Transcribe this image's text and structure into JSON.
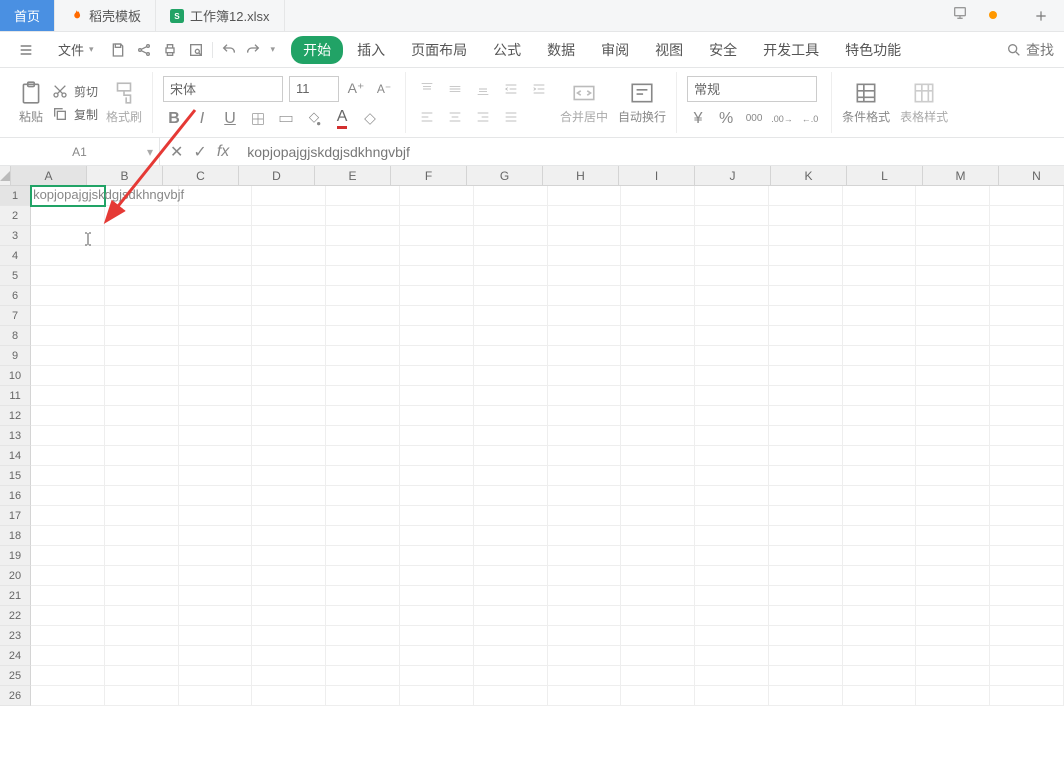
{
  "tabs": {
    "home": "首页",
    "template": "稻壳模板",
    "workbook": "工作簿12.xlsx"
  },
  "file_menu": "文件",
  "ribbon_tabs": {
    "start": "开始",
    "insert": "插入",
    "layout": "页面布局",
    "formula": "公式",
    "data": "数据",
    "review": "审阅",
    "view": "视图",
    "security": "安全",
    "dev": "开发工具",
    "special": "特色功能"
  },
  "search_label": "查找",
  "clipboard": {
    "paste": "粘贴",
    "cut": "剪切",
    "copy": "复制",
    "format_painter": "格式刷"
  },
  "font": {
    "name": "宋体",
    "size": "11",
    "bold": "B",
    "italic": "I",
    "underline": "U"
  },
  "merge": "合并居中",
  "wrap": "自动换行",
  "number_format": "常规",
  "cond_format": "条件格式",
  "table_style": "表格样式",
  "name_box": "A1",
  "fx_value": "kopjopajgjskdgjsdkhngvbjf",
  "cell_a1": "kopjopajgjskdgjsdkhngvbjf",
  "columns": [
    "A",
    "B",
    "C",
    "D",
    "E",
    "F",
    "G",
    "H",
    "I",
    "J",
    "K",
    "L",
    "M",
    "N"
  ],
  "rows": [
    "1",
    "2",
    "3",
    "4",
    "5",
    "6",
    "7",
    "8",
    "9",
    "10",
    "11",
    "12",
    "13",
    "14",
    "15",
    "16",
    "17",
    "18",
    "19",
    "20",
    "21",
    "22",
    "23",
    "24",
    "25",
    "26"
  ]
}
